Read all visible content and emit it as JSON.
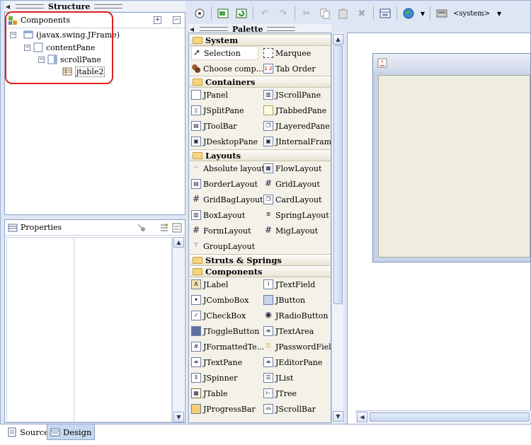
{
  "structure": {
    "title": "Structure",
    "components_header": "Components",
    "tree": [
      {
        "label": "(javax.swing.JFrame)"
      },
      {
        "label": "contentPane"
      },
      {
        "label": "scrollPane"
      },
      {
        "label": "jtable2"
      }
    ]
  },
  "properties": {
    "header": "Properties"
  },
  "palette": {
    "title": "Palette",
    "categories": {
      "system": "System",
      "containers": "Containers",
      "layouts": "Layouts",
      "struts": "Struts & Springs",
      "components": "Components"
    },
    "system_items": [
      "Selection",
      "Marquee",
      "Choose comp...",
      "Tab Order"
    ],
    "container_items": [
      "JPanel",
      "JScrollPane",
      "JSplitPane",
      "JTabbedPane",
      "JToolBar",
      "JLayeredPane",
      "JDesktopPane",
      "JInternalFrame"
    ],
    "layout_items": [
      "Absolute layout",
      "FlowLayout",
      "BorderLayout",
      "GridLayout",
      "GridBagLayout",
      "CardLayout",
      "BoxLayout",
      "SpringLayout",
      "FormLayout",
      "MigLayout",
      "GroupLayout"
    ],
    "component_items": [
      "JLabel",
      "JTextField",
      "JComboBox",
      "JButton",
      "JCheckBox",
      "JRadioButton",
      "JToggleButton",
      "JTextArea",
      "JFormattedTe...",
      "JPasswordField",
      "JTextPane",
      "JEditorPane",
      "JSpinner",
      "JList",
      "JTable",
      "JTree",
      "JProgressBar",
      "JScrollBar"
    ]
  },
  "toolbar": {
    "laf_select": "<system>"
  },
  "tabs": {
    "source": "Source",
    "design": "Design"
  },
  "colors": {
    "highlight": "#e02020",
    "accent": "#8ea4c8"
  }
}
